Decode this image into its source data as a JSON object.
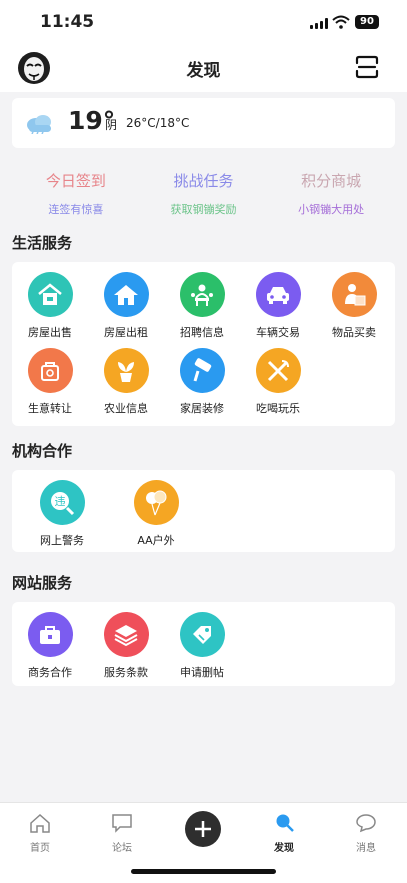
{
  "status": {
    "time": "11:45",
    "battery": "90"
  },
  "nav": {
    "title": "发现"
  },
  "weather": {
    "temp": "19°",
    "condition": "阴",
    "range": "26°C/18°C"
  },
  "quick": [
    {
      "title": "今日签到",
      "sub": "连签有惊喜",
      "title_color": "#e7848a",
      "sub_color": "#8a8ae8"
    },
    {
      "title": "挑战任务",
      "sub": "获取钢镚奖励",
      "title_color": "#8a8ae8",
      "sub_color": "#6cc48a"
    },
    {
      "title": "积分商城",
      "sub": "小钢镚大用处",
      "title_color": "#c9a6b0",
      "sub_color": "#a56ed8"
    }
  ],
  "sections": {
    "life": {
      "title": "生活服务",
      "items": [
        {
          "label": "房屋出售",
          "icon": "house-sale-icon",
          "color": "#2ec4b6"
        },
        {
          "label": "房屋出租",
          "icon": "house-rent-icon",
          "color": "#2a9af0"
        },
        {
          "label": "招聘信息",
          "icon": "recruit-icon",
          "color": "#2bbf6a"
        },
        {
          "label": "车辆交易",
          "icon": "car-icon",
          "color": "#7b5cf0"
        },
        {
          "label": "物品买卖",
          "icon": "goods-icon",
          "color": "#f28a3a"
        },
        {
          "label": "生意转让",
          "icon": "business-transfer-icon",
          "color": "#f2784a"
        },
        {
          "label": "农业信息",
          "icon": "plant-icon",
          "color": "#f5a623"
        },
        {
          "label": "家居装修",
          "icon": "paint-roller-icon",
          "color": "#2a9af0"
        },
        {
          "label": "吃喝玩乐",
          "icon": "utensils-icon",
          "color": "#f5a623"
        }
      ]
    },
    "org": {
      "title": "机构合作",
      "items": [
        {
          "label": "网上警务",
          "icon": "police-icon",
          "color": "#2ec4c4"
        },
        {
          "label": "AA户外",
          "icon": "balloon-icon",
          "color": "#f5a623"
        }
      ]
    },
    "site": {
      "title": "网站服务",
      "items": [
        {
          "label": "商务合作",
          "icon": "briefcase-icon",
          "color": "#7b5cf0"
        },
        {
          "label": "服务条款",
          "icon": "layers-icon",
          "color": "#ef4f5a"
        },
        {
          "label": "申请删帖",
          "icon": "tag-icon",
          "color": "#2ec4c4"
        }
      ]
    }
  },
  "tabs": [
    {
      "label": "首页",
      "icon": "home-icon"
    },
    {
      "label": "论坛",
      "icon": "forum-icon"
    },
    {
      "label": "发现",
      "icon": "search-icon",
      "active": true
    },
    {
      "label": "消息",
      "icon": "message-icon"
    }
  ]
}
